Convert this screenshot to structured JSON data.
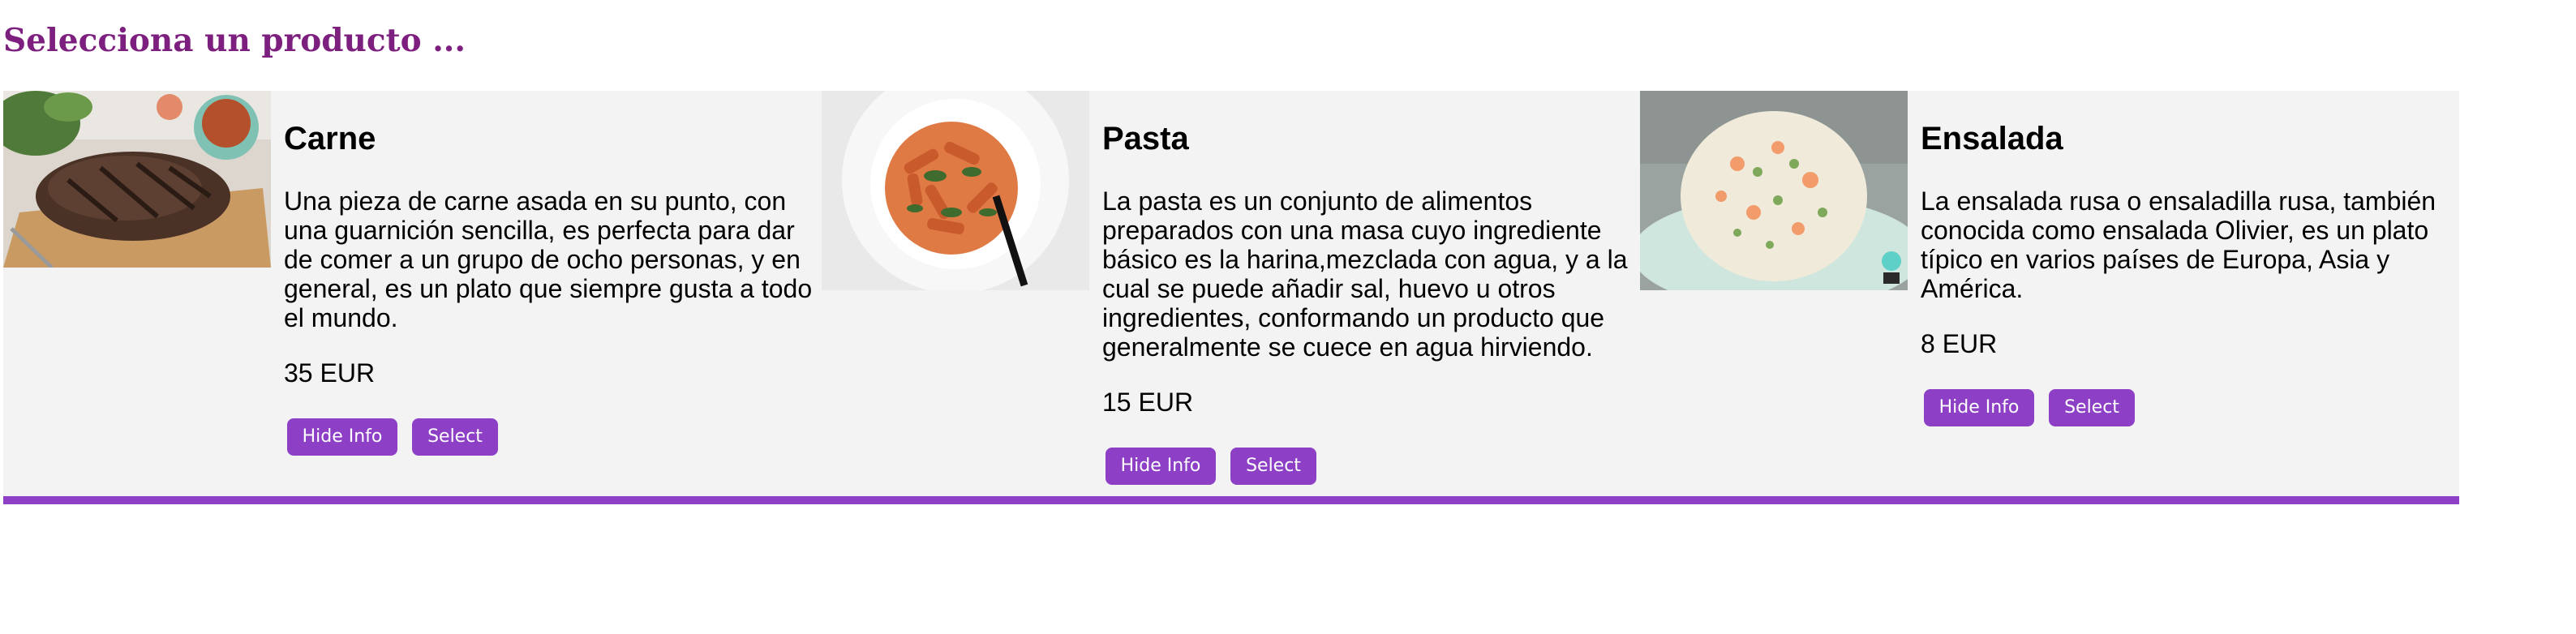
{
  "page": {
    "title": "Selecciona un producto ..."
  },
  "colors": {
    "title": "#7d1f7e",
    "accent": "#8d3fc5",
    "row_background": "#f3f3f3"
  },
  "products": [
    {
      "name": "Carne",
      "image_icon": "grilled-steak-image",
      "description": "Una pieza de carne asada en su punto, con una guarnición sencilla, es perfecta para dar de comer a un grupo de ocho personas, y en general, es un plato que siempre gusta a todo el mundo.",
      "price": "35 EUR",
      "hide_label": "Hide Info",
      "select_label": "Select"
    },
    {
      "name": "Pasta",
      "image_icon": "penne-pasta-image",
      "description": "La pasta es un conjunto de alimentos preparados con una masa cuyo ingrediente básico es la harina,mezclada con agua, y a la cual se puede añadir sal, huevo u otros ingredientes, conformando un producto que generalmente se cuece en agua hirviendo.",
      "price": "15 EUR",
      "hide_label": "Hide Info",
      "select_label": "Select"
    },
    {
      "name": "Ensalada",
      "image_icon": "russian-salad-image",
      "description": "La ensalada rusa o ensaladilla rusa, también conocida como ensalada Olivier, es un plato típico en varios países de Europa, Asia y América.",
      "price": "8 EUR",
      "hide_label": "Hide Info",
      "select_label": "Select"
    }
  ]
}
